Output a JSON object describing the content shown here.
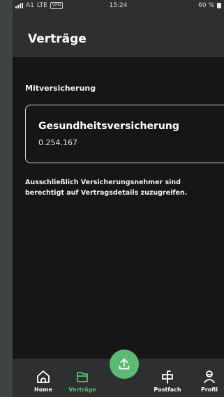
{
  "status_bar": {
    "carrier": "A1",
    "network": "LTE",
    "vpn": "VPN",
    "time": "15:24",
    "battery": "60 %"
  },
  "header": {
    "title": "Verträge"
  },
  "content": {
    "section_label": "Mitversicherung",
    "card": {
      "title": "Gesundheitsversicherung",
      "number": "0.254.167"
    },
    "note": "Ausschließlich Versicherungsnehmer sind berechtigt auf Vertragsdetails zuzugreifen."
  },
  "tabbar": {
    "home": {
      "label": "Home",
      "icon": "home-icon"
    },
    "contracts": {
      "label": "Verträge",
      "icon": "contracts-icon"
    },
    "upload": {
      "icon": "upload-icon"
    },
    "mailbox": {
      "label": "Postfach",
      "icon": "mailbox-icon"
    },
    "profile": {
      "label": "Profil",
      "icon": "profile-icon"
    }
  },
  "colors": {
    "accent": "#5dba74",
    "background": "#161616",
    "bars": "#2d302f"
  }
}
